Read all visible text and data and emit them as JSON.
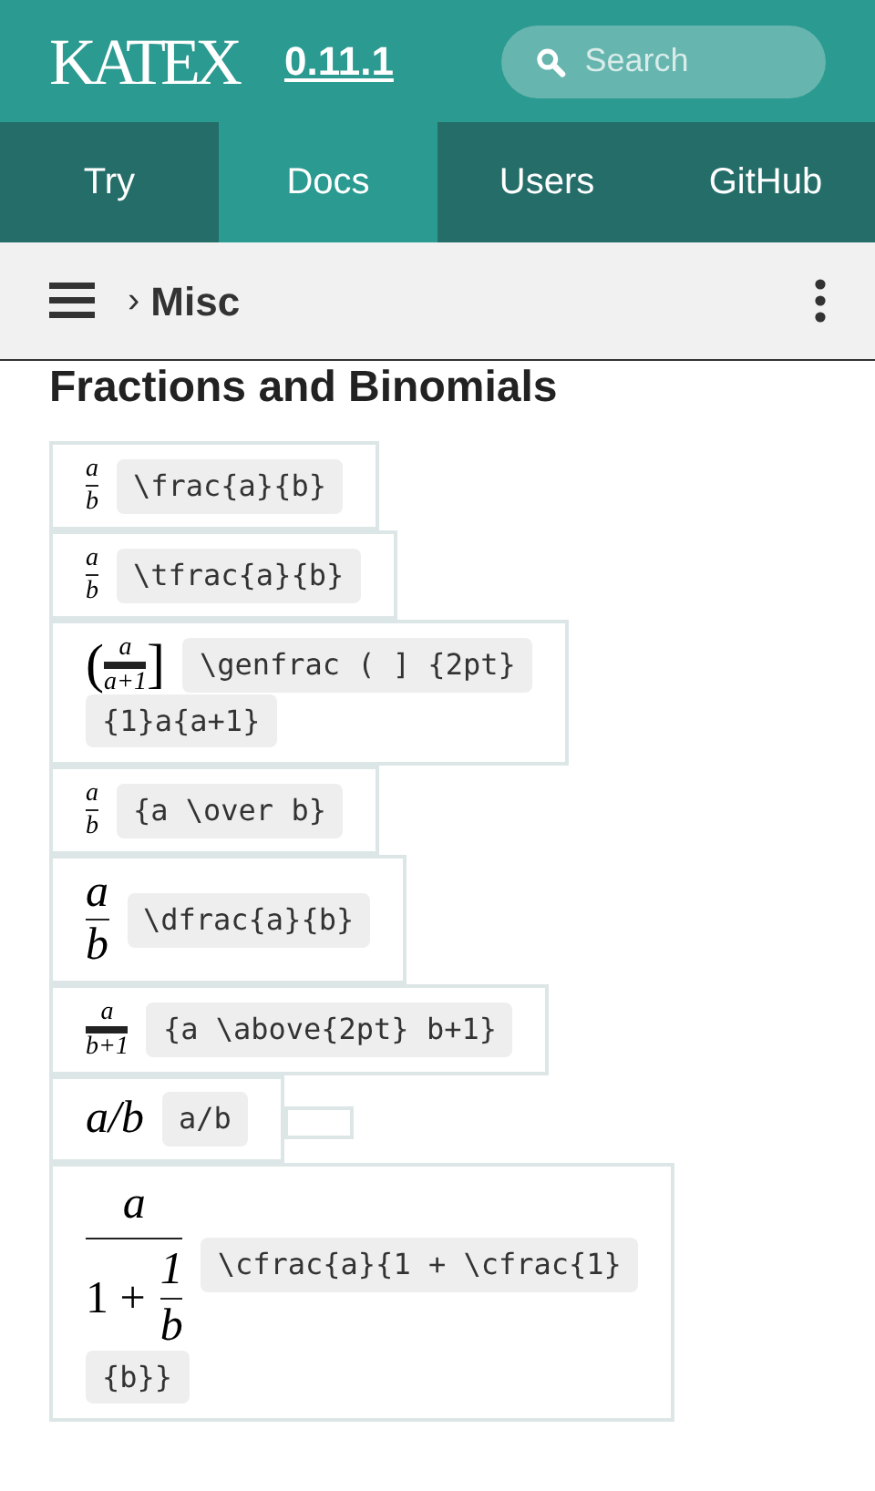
{
  "header": {
    "logo": "KATEX",
    "version": "0.11.1",
    "search": {
      "placeholder": "Search"
    }
  },
  "nav": [
    {
      "label": "Try",
      "selected": false
    },
    {
      "label": "Docs",
      "selected": true
    },
    {
      "label": "Users",
      "selected": false
    },
    {
      "label": "GitHub",
      "selected": false
    }
  ],
  "toolbar": {
    "breadcrumb_separator": "›",
    "breadcrumb": "Misc"
  },
  "heading": "Fractions and Binomials",
  "examples": [
    {
      "kind": "frac",
      "thick": false,
      "num": "a",
      "den": "b",
      "code": [
        "\\frac{a}{b}"
      ]
    },
    {
      "kind": "frac",
      "thick": false,
      "num": "a",
      "den": "b",
      "code": [
        "\\tfrac{a}{b}"
      ]
    },
    {
      "kind": "frac",
      "thick": true,
      "left": "(",
      "right": "]",
      "num": "a",
      "den": "a+1",
      "code": [
        "\\genfrac ( ] {2pt}",
        "{1}a{a+1}"
      ]
    },
    {
      "kind": "frac",
      "thick": false,
      "num": "a",
      "den": "b",
      "code": [
        "{a \\over b}"
      ]
    },
    {
      "kind": "dfrac",
      "thick": false,
      "num": "a",
      "den": "b",
      "code": [
        "\\dfrac{a}{b}"
      ]
    },
    {
      "kind": "frac",
      "thick": true,
      "num": "a",
      "den": "b+1",
      "code": [
        "{a \\above{2pt} b+1}"
      ]
    },
    {
      "kind": "inline",
      "math": "a/b",
      "code": [
        "a/b"
      ],
      "empty_box": true
    },
    {
      "kind": "cfrac",
      "num": "a",
      "den_lead": "1 +",
      "inner_num": "1",
      "inner_den": "b",
      "code": [
        "\\cfrac{a}{1 + \\cfrac{1}",
        "{b}}"
      ]
    }
  ]
}
